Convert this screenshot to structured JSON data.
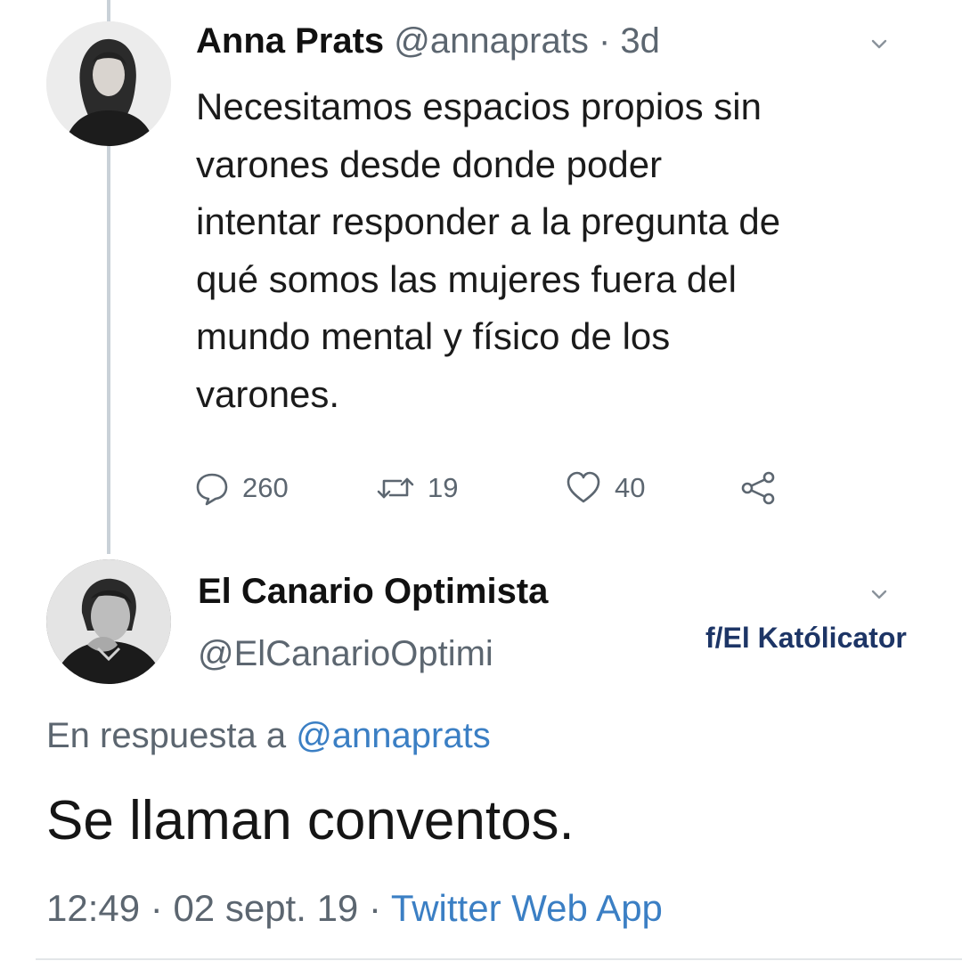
{
  "tweet": {
    "author_name": "Anna Prats",
    "handle": "@annaprats",
    "separator": "·",
    "time": "3d",
    "text_lines": [
      "Necesitamos espacios propios sin",
      "varones desde donde poder",
      "intentar responder a la pregunta de",
      "qué somos las mujeres fuera del",
      "mundo mental y físico de los",
      "varones."
    ],
    "actions": {
      "reply_count": "260",
      "retweet_count": "19",
      "like_count": "40"
    }
  },
  "reply": {
    "author_name": "El Canario Optimista",
    "handle": "@ElCanarioOptimi",
    "in_reply_prefix": "En respuesta a",
    "in_reply_mention": "@annaprats",
    "text": "Se llaman conventos.",
    "time": "12:49",
    "separator1": "·",
    "date": "02 sept. 19",
    "separator2": "·",
    "source": "Twitter Web App"
  },
  "watermark": "f/El Katólicator",
  "icons": {
    "reply": "reply-icon",
    "retweet": "retweet-icon",
    "like": "heart-icon",
    "share": "share-icon",
    "chevron": "chevron-down-icon"
  },
  "colors": {
    "link_blue": "#3b7fc4",
    "muted_gray": "#5c6670",
    "watermark_navy": "#1d3566",
    "thread_line": "#c9d1d8"
  }
}
